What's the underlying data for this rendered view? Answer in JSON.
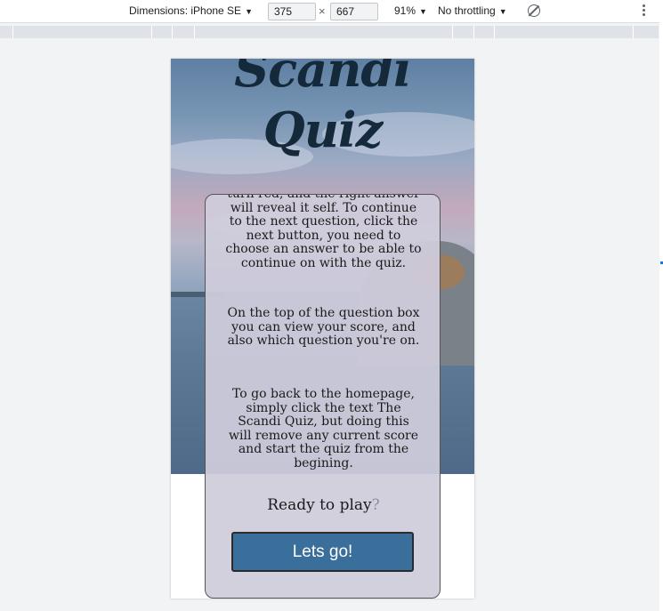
{
  "devtools": {
    "dimensions_label": "Dimensions: iPhone SE",
    "width_value": "375",
    "height_value": "667",
    "times_symbol": "×",
    "zoom": "91%",
    "throttling": "No throttling",
    "caret": "▼"
  },
  "page": {
    "title_line1": "Scandi",
    "title_line2": "Quiz",
    "paragraph1": "turn red, and the right answer will reveal it self. To continue to the next question, click the next button, you need to choose an answer to be able to continue on with the quiz.",
    "paragraph2": "On the top of the question box you can view your score, and also which question you're on.",
    "paragraph3": "To go back to the homepage, simply click the text The Scandi Quiz, but doing this will remove any current score and start the quiz from the begining.",
    "ready_text": "Ready to play",
    "ready_mark": "?",
    "start_button": "Lets go!"
  }
}
